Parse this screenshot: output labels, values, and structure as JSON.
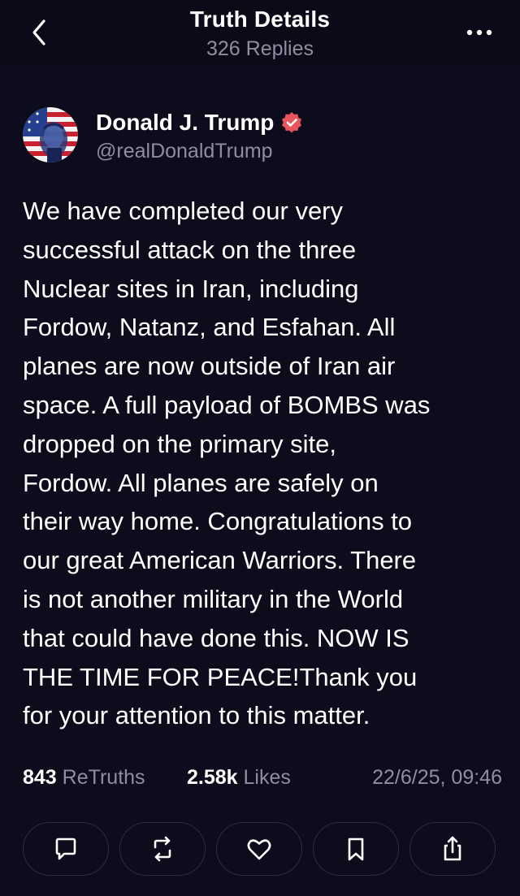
{
  "header": {
    "title": "Truth Details",
    "subtitle": "326 Replies"
  },
  "post": {
    "author_name": "Donald J. Trump",
    "author_handle": "@realDonaldTrump",
    "verified": true,
    "body_lines": [
      "We have completed our very",
      "successful attack on the three",
      "Nuclear sites in Iran, including",
      "Fordow, Natanz, and Esfahan. All",
      "planes are now outside of Iran air",
      "space. A full payload of BOMBS was",
      "dropped on the primary site,",
      "Fordow. All planes are safely on",
      "their way home. Congratulations to",
      "our great American Warriors. There",
      "is not another military in the World",
      "that could have done this. NOW IS",
      "THE TIME FOR PEACE!Thank you",
      "for your attention to this matter."
    ],
    "retruths_count": "843",
    "retruths_label": "ReTruths",
    "likes_count": "2.58k",
    "likes_label": "Likes",
    "timestamp": "22/6/25, 09:46"
  },
  "actions": [
    {
      "icon": "reply-icon"
    },
    {
      "icon": "retruth-icon"
    },
    {
      "icon": "heart-icon"
    },
    {
      "icon": "bookmark-icon"
    },
    {
      "icon": "share-icon"
    }
  ],
  "colors": {
    "background": "#0d0c1c",
    "text_primary": "#ffffff",
    "text_secondary": "#8e8e9e",
    "verified_badge": "#e8555f",
    "button_border": "#2e2c42"
  }
}
